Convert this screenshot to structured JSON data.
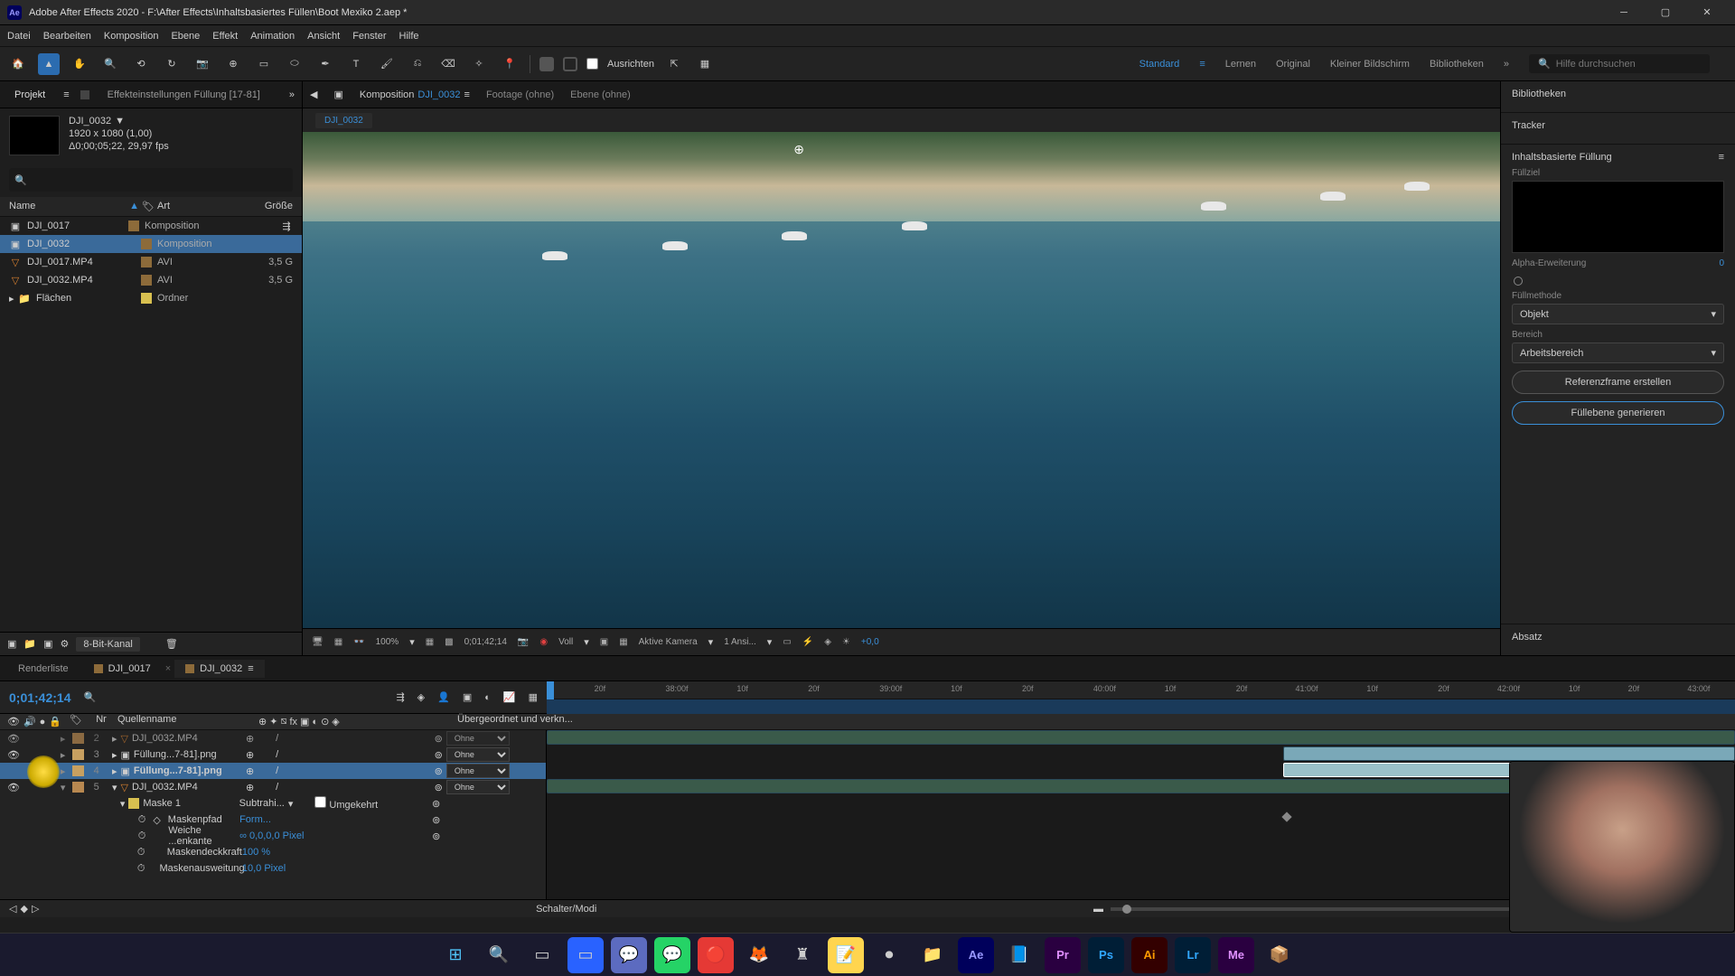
{
  "titlebar": {
    "app_icon": "Ae",
    "title": "Adobe After Effects 2020 - F:\\After Effects\\Inhaltsbasiertes Füllen\\Boot Mexiko 2.aep *"
  },
  "menu": [
    "Datei",
    "Bearbeiten",
    "Komposition",
    "Ebene",
    "Effekt",
    "Animation",
    "Ansicht",
    "Fenster",
    "Hilfe"
  ],
  "toolbar": {
    "align_label": "Ausrichten",
    "workspaces": [
      "Standard",
      "Lernen",
      "Original",
      "Kleiner Bildschirm",
      "Bibliotheken"
    ],
    "active_workspace": "Standard",
    "search_placeholder": "Hilfe durchsuchen"
  },
  "left_panel": {
    "tabs": {
      "projekt": "Projekt",
      "effekt": "Effekteinstellungen Füllung  [17-81]"
    },
    "comp_name": "DJI_0032",
    "comp_res": "1920 x 1080 (1,00)",
    "comp_dur": "Δ0;00;05;22, 29,97 fps",
    "header": {
      "name": "Name",
      "art": "Art",
      "groesse": "Größe"
    },
    "items": [
      {
        "name": "DJI_0017",
        "art": "Komposition",
        "size": "",
        "icon": "comp",
        "color": "#8d6b3a"
      },
      {
        "name": "DJI_0032",
        "art": "Komposition",
        "size": "",
        "icon": "comp",
        "color": "#8d6b3a",
        "selected": true
      },
      {
        "name": "DJI_0017.MP4",
        "art": "AVI",
        "size": "3,5 G",
        "icon": "video",
        "color": "#8d6b3a"
      },
      {
        "name": "DJI_0032.MP4",
        "art": "AVI",
        "size": "3,5 G",
        "icon": "video",
        "color": "#8d6b3a"
      },
      {
        "name": "Flächen",
        "art": "Ordner",
        "size": "",
        "icon": "folder",
        "color": "#d8c050"
      }
    ],
    "footer_depth": "8-Bit-Kanal"
  },
  "center_panel": {
    "tabs": {
      "komposition_label": "Komposition",
      "komposition_name": "DJI_0032",
      "footage": "Footage  (ohne)",
      "ebene": "Ebene  (ohne)"
    },
    "breadcrumb": "DJI_0032",
    "controls": {
      "zoom": "100%",
      "timecode": "0;01;42;14",
      "resolution": "Voll",
      "camera": "Aktive Kamera",
      "views": "1 Ansi...",
      "exposure": "+0,0"
    }
  },
  "right_panel": {
    "sections": {
      "bibliotheken": "Bibliotheken",
      "tracker": "Tracker",
      "inhaltsbasiert": "Inhaltsbasierte Füllung",
      "absatz": "Absatz"
    },
    "fill": {
      "fullziel": "Füllziel",
      "alpha_label": "Alpha-Erweiterung",
      "alpha_value": "0",
      "method_label": "Füllmethode",
      "method_value": "Objekt",
      "bereich_label": "Bereich",
      "bereich_value": "Arbeitsbereich",
      "ref_button": "Referenzframe erstellen",
      "gen_button": "Füllebene generieren"
    }
  },
  "timeline": {
    "tabs": {
      "render": "Renderliste",
      "t1": "DJI_0017",
      "t2": "DJI_0032"
    },
    "timecode": "0;01;42;14",
    "cols": {
      "nr": "Nr",
      "quelle": "Quellenname",
      "parent": "Übergeordnet und verkn..."
    },
    "ruler_ticks": [
      "20f",
      "38:00f",
      "10f",
      "20f",
      "39:00f",
      "10f",
      "20f",
      "40:00f",
      "10f",
      "20f",
      "41:00f",
      "10f",
      "20f",
      "42:00f",
      "10f",
      "20f",
      "43:00f"
    ],
    "layers": [
      {
        "num": "2",
        "name": "DJI_0032.MP4",
        "icon": "video",
        "parent": "Ohne"
      },
      {
        "num": "3",
        "name": "Füllung...7-81].png",
        "icon": "img",
        "parent": "Ohne"
      },
      {
        "num": "4",
        "name": "Füllung...7-81].png",
        "icon": "img",
        "parent": "Ohne",
        "selected": true
      },
      {
        "num": "5",
        "name": "DJI_0032.MP4",
        "icon": "video",
        "parent": "Ohne"
      }
    ],
    "mask": {
      "name": "Maske 1",
      "mode": "Subtrahi...",
      "invert": "Umgekehrt",
      "props": [
        {
          "label": "Maskenpfad",
          "value": "Form..."
        },
        {
          "label": "Weiche ...enkante",
          "value": "∞ 0,0,0,0 Pixel"
        },
        {
          "label": "Maskendeckkraft",
          "value": "100 %"
        },
        {
          "label": "Maskenausweitung",
          "value": "10,0 Pixel"
        }
      ]
    },
    "footer": "Schalter/Modi"
  },
  "taskbar_icons": [
    "⊞",
    "🔍",
    "▭",
    "▭",
    "💬",
    "💬",
    "🔴",
    "🦊",
    "♜",
    "📝",
    "⏺",
    "📁",
    "Ae",
    "📘",
    "Pr",
    "Ps",
    "Ai",
    "Lr",
    "Me",
    "📦"
  ]
}
